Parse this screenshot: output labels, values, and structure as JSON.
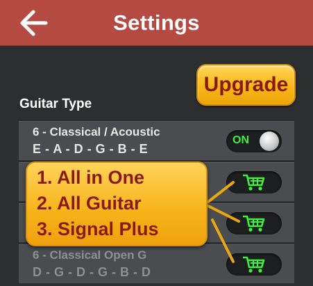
{
  "header": {
    "title": "Settings",
    "back_icon": "arrow-left-icon",
    "background": "#b44a42"
  },
  "upgrade": {
    "label": "Upgrade",
    "color": "#f7b717",
    "text_color": "#8b1a10"
  },
  "guitar_type": {
    "label": "Guitar Type",
    "rows": [
      {
        "name": "6 - Classical / Acoustic",
        "tuning": "E - A - D - G - B - E",
        "control": "toggle",
        "toggle_text": "ON"
      },
      {
        "name": "",
        "tuning": "",
        "control": "cart"
      },
      {
        "name": "",
        "tuning": "",
        "control": "cart"
      },
      {
        "name": "6 - Classical Open G",
        "tuning": "D - G - D - G - B - D",
        "control": "cart"
      }
    ]
  },
  "callout": {
    "items": [
      "1. All in One",
      "2. All Guitar",
      "3. Signal Plus"
    ]
  },
  "icons": {
    "cart": "shopping-cart-icon",
    "cart_color": "#3cf23a"
  }
}
